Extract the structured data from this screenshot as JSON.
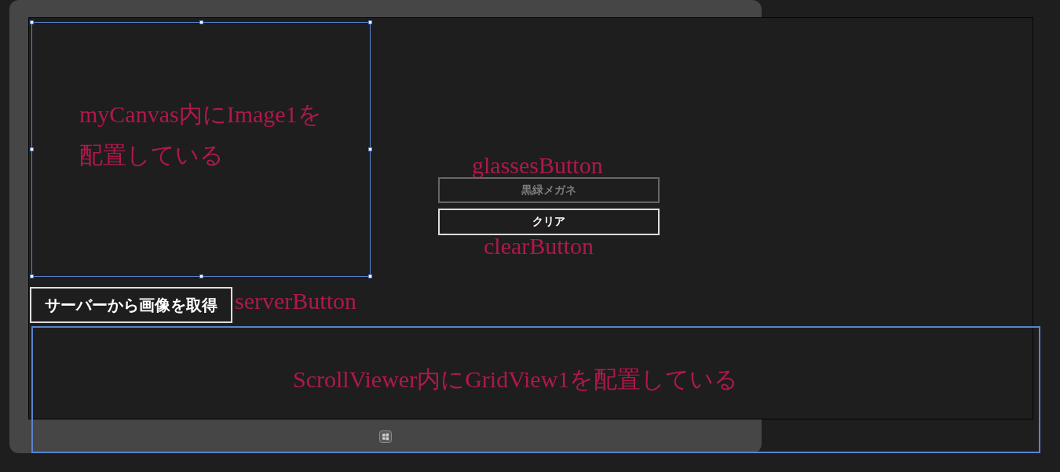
{
  "canvas": {
    "selected": true,
    "annotation_lines": [
      "myCanvas内にImage1を",
      "配置している"
    ]
  },
  "server_button": {
    "label": "サーバーから画像を取得",
    "disabled": false,
    "annotation": "serverButton"
  },
  "glasses_button": {
    "label": "黒緑メガネ",
    "disabled": true,
    "annotation": "glassesButton"
  },
  "clear_button": {
    "label": "クリア",
    "disabled": false,
    "annotation": "clearButton"
  },
  "scroll_viewer": {
    "selected": true,
    "annotation": "ScrollViewer内にGridView1を配置している"
  }
}
